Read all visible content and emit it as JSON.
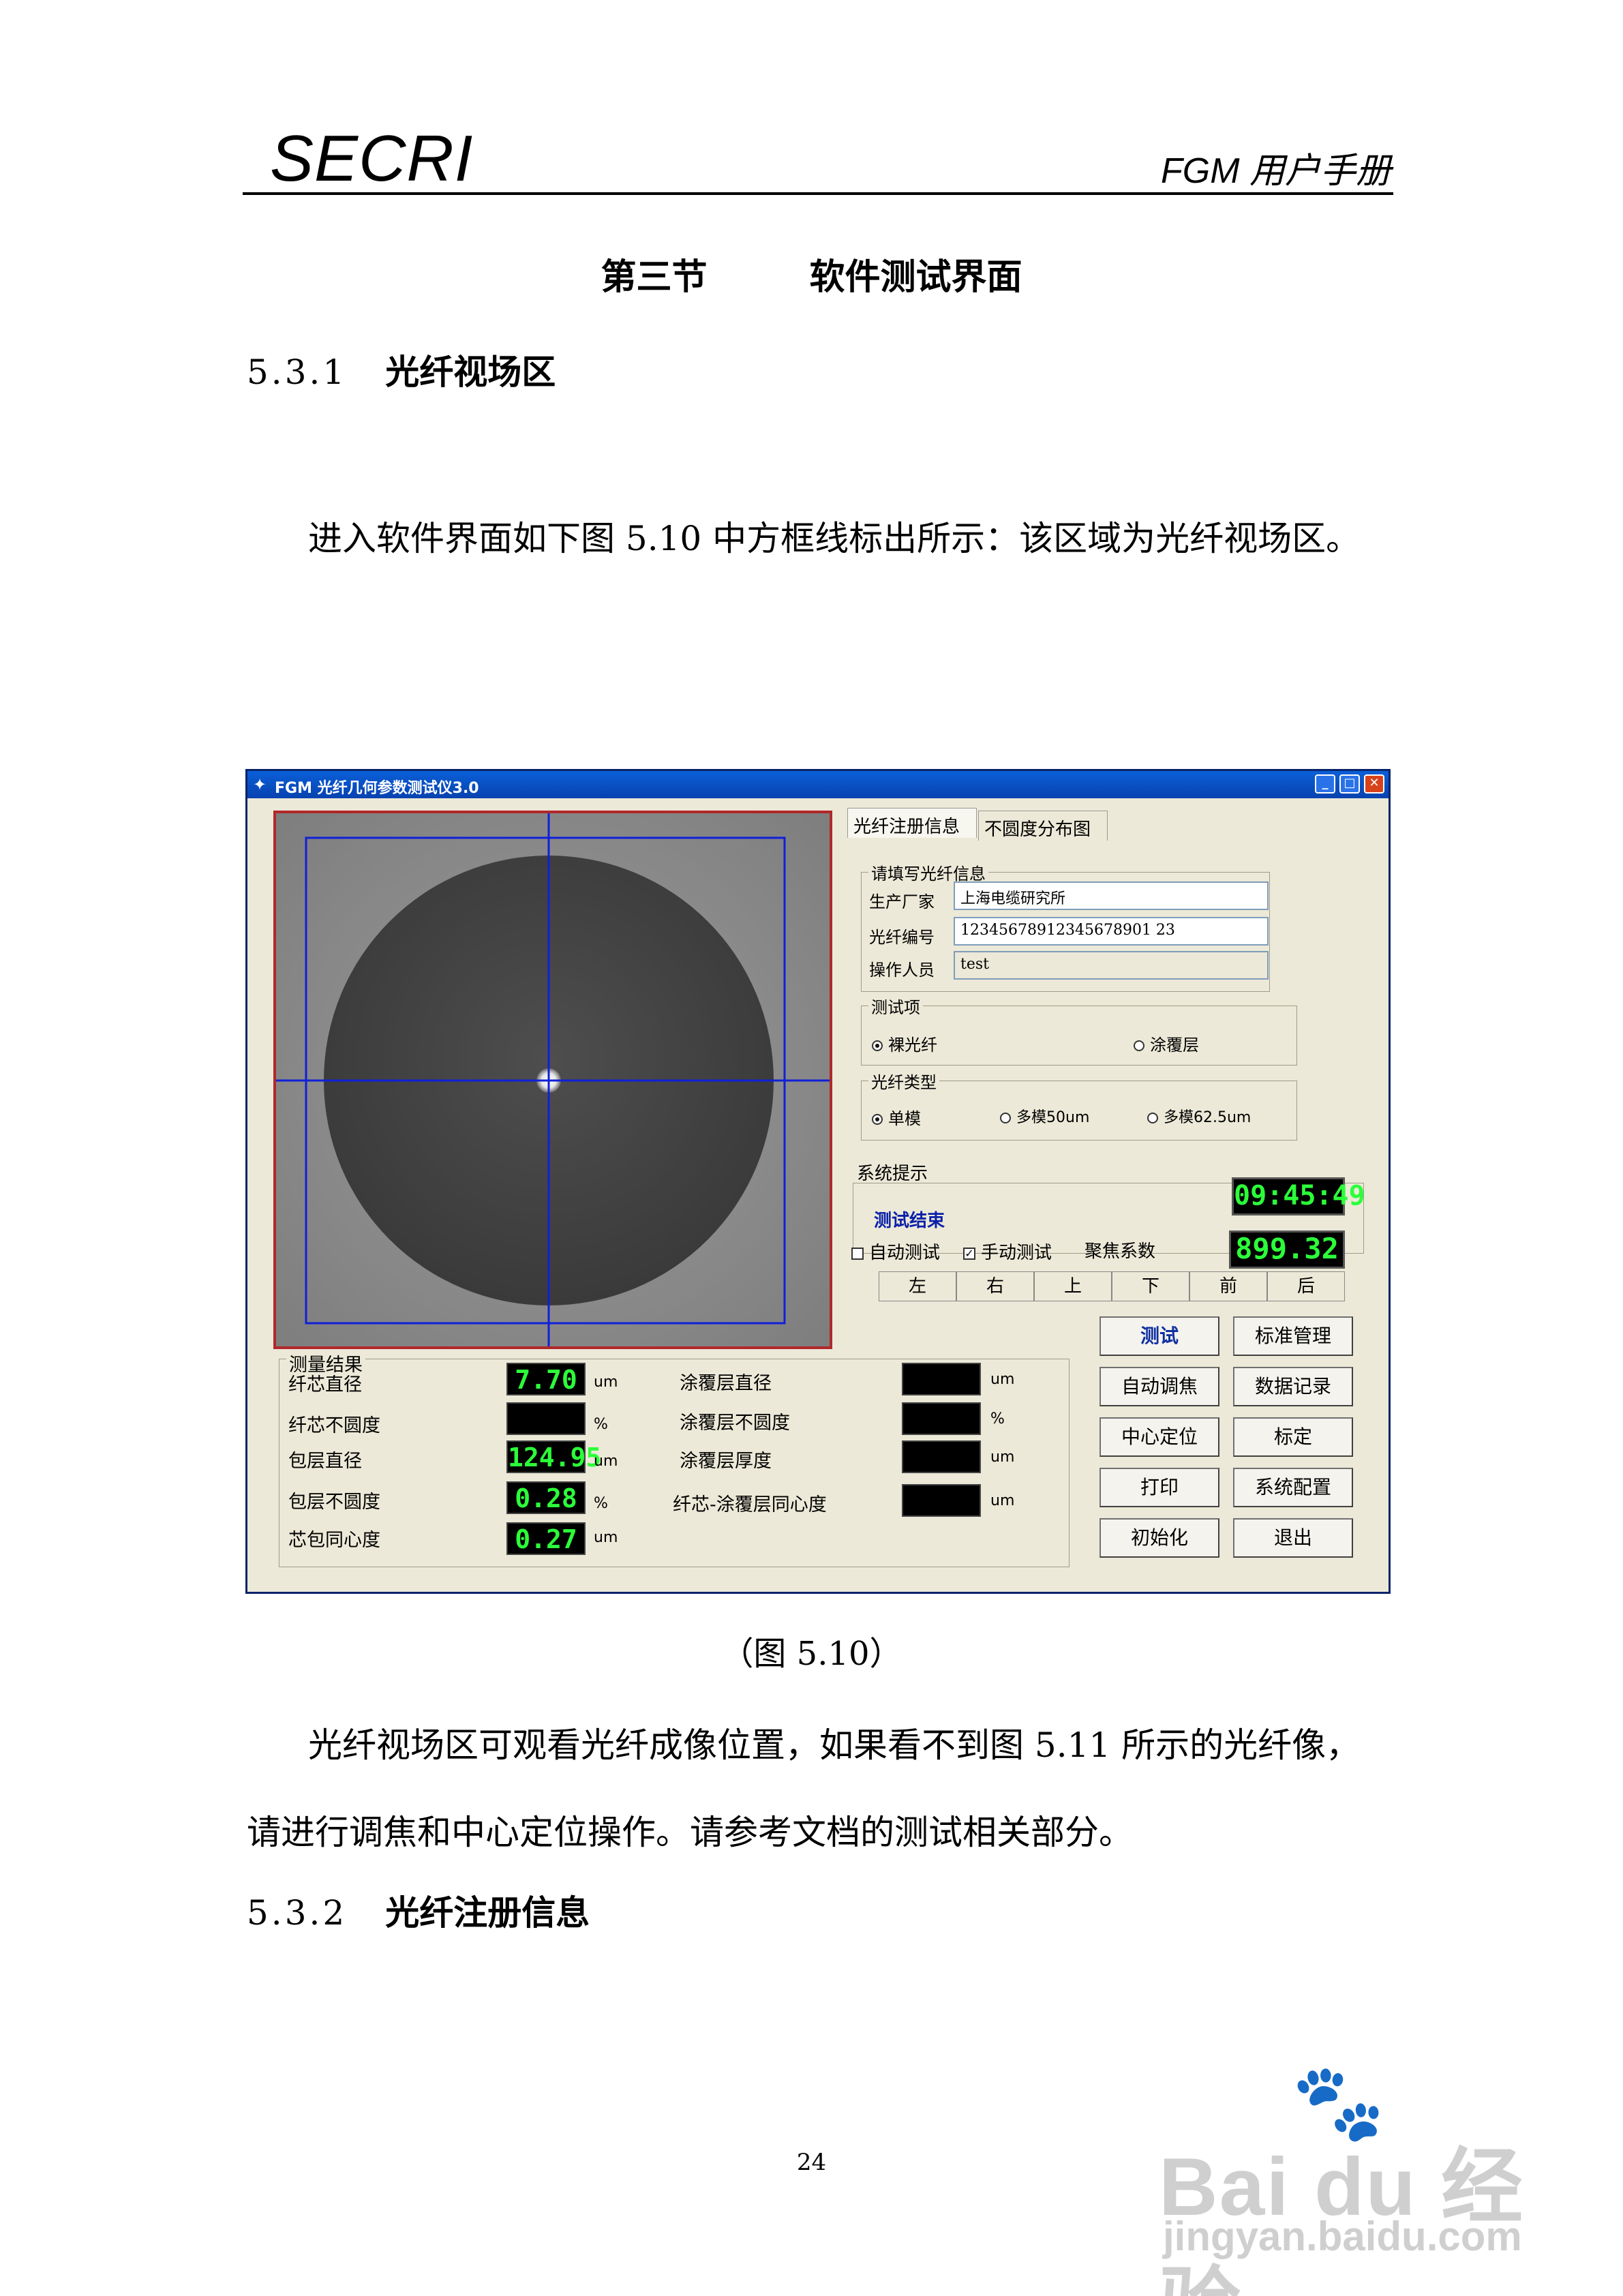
{
  "header": {
    "logo": "SECRI",
    "manual_title": "FGM 用户手册"
  },
  "section": {
    "number": "第三节",
    "title": "软件测试界面"
  },
  "sub1": {
    "number": "5.3.1",
    "title": "光纤视场区"
  },
  "para1": "进入软件界面如下图 5.10 中方框线标出所示：该区域为光纤视场区。",
  "caption": "（图 5.10）",
  "para2": "光纤视场区可观看光纤成像位置，如果看不到图 5.11 所示的光纤像，请进行调焦和中心定位操作。请参考文档的测试相关部分。",
  "sub2": {
    "number": "5.3.2",
    "title": "光纤注册信息"
  },
  "page_number": "24",
  "watermark": {
    "brand": "Bai du 经验",
    "url": "jingyan.baidu.com"
  },
  "app": {
    "title": "FGM  光纤几何参数测试仪3.0",
    "tabs": [
      "光纤注册信息",
      "不圆度分布图"
    ],
    "reg": {
      "group_label": "请填写光纤信息",
      "manufacturer_label": "生产厂家",
      "manufacturer_value": "上海电缆研究所",
      "fiber_id_label": "光纤编号",
      "fiber_id_value": "12345678912345678901 23",
      "operator_label": "操作人员",
      "operator_value": "test"
    },
    "test_item": {
      "label": "测试项",
      "options": [
        "裸光纤",
        "涂覆层"
      ],
      "selected": "裸光纤"
    },
    "fiber_type": {
      "label": "光纤类型",
      "options": [
        "单模",
        "多模50um",
        "多模62.5um"
      ],
      "selected": "单模"
    },
    "system": {
      "label": "系统提示",
      "message": "测试结束",
      "clock": "09:45:49"
    },
    "controls": {
      "auto_test": "自动测试",
      "auto_checked": false,
      "manual_test": "手动测试",
      "manual_checked": true,
      "focus_label": "聚焦系数",
      "focus_value": "899.32"
    },
    "direction": [
      "左",
      "右",
      "上",
      "下",
      "前",
      "后"
    ],
    "buttons": [
      "测试",
      "标准管理",
      "自动调焦",
      "数据记录",
      "中心定位",
      "标定",
      "打印",
      "系统配置",
      "初始化",
      "退出"
    ],
    "results": {
      "label": "测量结果",
      "left": [
        {
          "name": "纤芯直径",
          "value": "7.70",
          "unit": "um"
        },
        {
          "name": "纤芯不圆度",
          "value": "",
          "unit": "%"
        },
        {
          "name": "包层直径",
          "value": "124.95",
          "unit": "um"
        },
        {
          "name": "包层不圆度",
          "value": "0.28",
          "unit": "%"
        },
        {
          "name": "芯包同心度",
          "value": "0.27",
          "unit": "um"
        }
      ],
      "right": [
        {
          "name": "涂覆层直径",
          "value": "",
          "unit": "um"
        },
        {
          "name": "涂覆层不圆度",
          "value": "",
          "unit": "%"
        },
        {
          "name": "涂覆层厚度",
          "value": "",
          "unit": "um"
        },
        {
          "name": "纤芯-涂覆层同心度",
          "value": "",
          "unit": "um"
        }
      ]
    }
  }
}
